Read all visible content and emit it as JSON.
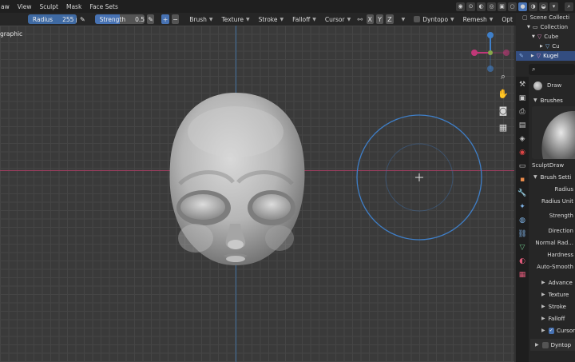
{
  "menu": {
    "items": [
      "aw",
      "View",
      "Sculpt",
      "Mask",
      "Face Sets"
    ],
    "right_icons": [
      "object-mode-icon",
      "snapping-icon",
      "sphere-shading-icon",
      "sphere-shading-icon",
      "sphere-shading-icon",
      "sphere-shading-icon"
    ]
  },
  "header": {
    "radius_label": "Radius",
    "radius_value": "255 px",
    "strength_label": "Strength",
    "strength_value": "0.500",
    "strength_fraction": 0.5,
    "menus": [
      "Brush",
      "Texture",
      "Stroke",
      "Falloff",
      "Cursor"
    ],
    "symmetry": [
      "X",
      "Y",
      "Z"
    ],
    "dyntopo_label": "Dyntopo",
    "remesh_label": "Remesh",
    "opt_label": "Opt"
  },
  "viewport": {
    "view_label": "graphic"
  },
  "outliner": {
    "rows": [
      {
        "label": "Scene Collecti",
        "indent": 0,
        "icon": "scene-icon",
        "selected": false
      },
      {
        "label": "Collection",
        "indent": 1,
        "icon": "collection-icon",
        "selected": false
      },
      {
        "label": "Cube",
        "indent": 2,
        "icon": "mesh-icon",
        "selected": false
      },
      {
        "label": "Cu",
        "indent": 3,
        "icon": "mesh-data-icon",
        "selected": false
      },
      {
        "label": "Kugel",
        "indent": 2,
        "icon": "mesh-icon",
        "selected": true
      }
    ]
  },
  "properties": {
    "tool_name": "Draw",
    "brushes_label": "Brushes",
    "brush_name": "SculptDraw",
    "brush_settings_label": "Brush Setti",
    "rows": [
      "Radius",
      "Radius Unit",
      "Strength",
      "Direction",
      "Normal Rad...",
      "Hardness",
      "Auto-Smooth"
    ],
    "subpanels": [
      "Advance",
      "Texture",
      "Stroke",
      "Falloff",
      "Cursor"
    ],
    "dyntopo_label": "Dyntop"
  },
  "colors": {
    "accent": "#4772b3",
    "x_axis": "#9a3d5e",
    "y_axis": "#3d6c9a",
    "brush_cursor": "#3f7fc8"
  }
}
